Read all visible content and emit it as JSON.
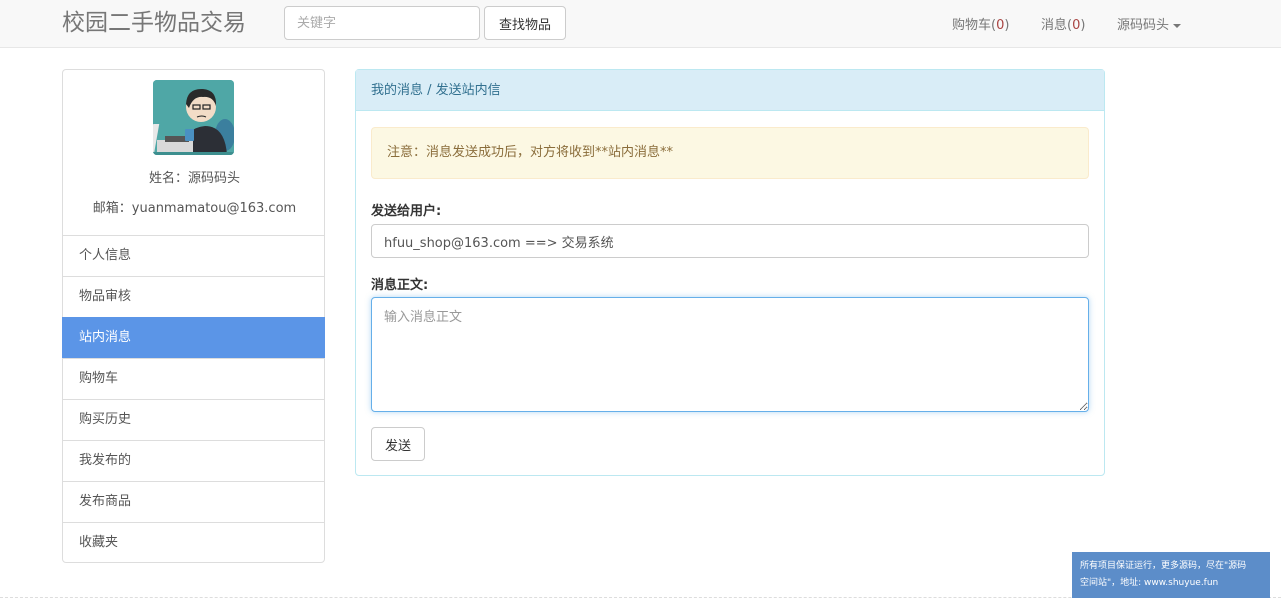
{
  "navbar": {
    "brand": "校园二手物品交易",
    "search_placeholder": "关键字",
    "search_button": "查找物品",
    "cart_label": "购物车(",
    "cart_count": "0",
    "cart_close": ")",
    "messages_label": "消息(",
    "messages_count": "0",
    "messages_close": ")",
    "user_menu": "源码码头"
  },
  "profile": {
    "name": "姓名：源码码头",
    "email": "邮箱：yuanmamatou@163.com"
  },
  "sidebar": {
    "items": [
      {
        "label": "个人信息"
      },
      {
        "label": "物品审核"
      },
      {
        "label": "站内消息"
      },
      {
        "label": "购物车"
      },
      {
        "label": "购买历史"
      },
      {
        "label": "我发布的"
      },
      {
        "label": "发布商品"
      },
      {
        "label": "收藏夹"
      }
    ]
  },
  "panel": {
    "breadcrumb": "我的消息 / 发送站内信",
    "notice": "注意：消息发送成功后，对方将收到**站内消息**",
    "to_label": "发送给用户:",
    "to_value": "hfuu_shop@163.com ==> 交易系统",
    "body_label": "消息正文:",
    "body_placeholder": "输入消息正文",
    "send_button": "发送"
  },
  "watermark": {
    "line1": "所有项目保证运行，更多源码，尽在\"源码",
    "line2": "空间站\"，地址: www.shuyue.fun"
  },
  "colors": {
    "active_menu": "#5b95e7",
    "panel_heading": "#d9edf7",
    "alert_bg": "#fcf8e3",
    "watermark_bg": "#5c8dc9"
  }
}
